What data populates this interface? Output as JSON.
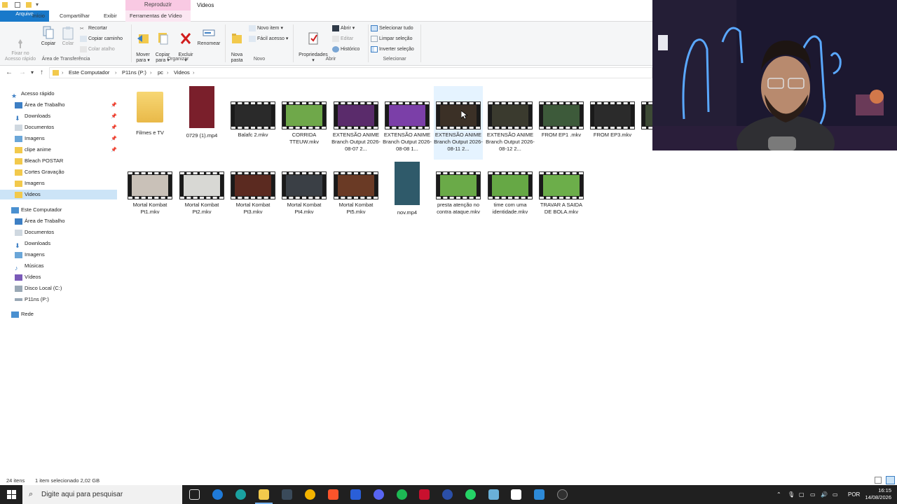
{
  "window": {
    "title": "Videos",
    "context_header": "Reproduzir"
  },
  "tabs": [
    {
      "label": "Arquivo"
    },
    {
      "label": "Início"
    },
    {
      "label": "Compartilhar"
    },
    {
      "label": "Exibir"
    },
    {
      "label": "Ferramentas de Vídeo"
    }
  ],
  "ribbon": {
    "clipboard": {
      "pin": "Fixar no\nAcesso rápido",
      "copy": "Copiar",
      "paste": "Colar",
      "cut": "Recortar",
      "copy_path": "Copiar caminho",
      "paste_shortcut": "Colar atalho",
      "group": "Área de Transferência"
    },
    "organize": {
      "move": "Mover\npara ▾",
      "copyto": "Copiar\npara ▾",
      "delete": "Excluir\n▾",
      "rename": "Renomear",
      "group": "Organizar"
    },
    "new": {
      "new_folder": "Nova\npasta",
      "new_item": "Novo item ▾",
      "easy_access": "Fácil acesso ▾",
      "group": "Novo"
    },
    "open": {
      "properties": "Propriedades\n▾",
      "open": "Abrir ▾",
      "edit": "Editar",
      "history": "Histórico",
      "group": "Abrir"
    },
    "select": {
      "select_all": "Selecionar tudo",
      "select_none": "Limpar seleção",
      "invert": "Inverter seleção",
      "group": "Selecionar"
    }
  },
  "address": {
    "crumbs": [
      "Este Computador",
      "P11ns (P:)",
      "pc",
      "Videos"
    ]
  },
  "nav": {
    "quick_access": "Acesso rápido",
    "quick_items": [
      "Área de Trabalho",
      "Downloads",
      "Documentos",
      "Imagens",
      "clipe anime",
      "Bleach POSTAR",
      "Cortes Gravação",
      "Imagens",
      "Videos"
    ],
    "this_pc": "Este Computador",
    "pc_items": [
      "Área de Trabalho",
      "Documentos",
      "Downloads",
      "Imagens",
      "Músicas",
      "Vídeos",
      "Disco Local (C:)",
      "P11ns (P:)"
    ],
    "network": "Rede"
  },
  "files": [
    {
      "name": "Filmes e TV",
      "kind": "folder"
    },
    {
      "name": "0729 (1).mp4",
      "kind": "portrait",
      "color": "#7a1f2b"
    },
    {
      "name": "Balafc 2.mkv",
      "kind": "video",
      "color": "#2a2a2a"
    },
    {
      "name": "CORRIDA TTEUW.mkv",
      "kind": "video",
      "color": "#6fa84a"
    },
    {
      "name": "EXTENSÃO ANIME Branch Output 2026-08-07 2...",
      "kind": "video",
      "color": "#5a2b6b"
    },
    {
      "name": "EXTENSÃO ANIME Branch Output 2026-08-08 1...",
      "kind": "video",
      "color": "#7b3fa8"
    },
    {
      "name": "EXTENSÃO ANIME Branch Output 2026-08-11 2...",
      "kind": "video",
      "color": "#3b3026",
      "selected": true
    },
    {
      "name": "EXTENSÃO ANIME Branch Output 2026-08-12 2...",
      "kind": "video",
      "color": "#3a3a2e"
    },
    {
      "name": "FROM EP1 .mkv",
      "kind": "video",
      "color": "#3d5a3a"
    },
    {
      "name": "FROM EP3.mkv",
      "kind": "video",
      "color": "#2b2b2b"
    },
    {
      "name": "FR",
      "kind": "video",
      "color": "#3d4a35"
    },
    {
      "name": "Mortal Kombat Pt1.mkv",
      "kind": "video",
      "color": "#c9c1b8"
    },
    {
      "name": "Mortal Kombat Pt2.mkv",
      "kind": "video",
      "color": "#d8d8d4"
    },
    {
      "name": "Mortal Kombat Pt3.mkv",
      "kind": "video",
      "color": "#5b2a20"
    },
    {
      "name": "Mortal Kombat Pt4.mkv",
      "kind": "video",
      "color": "#3a3f45"
    },
    {
      "name": "Mortal Kombat Pt5.mkv",
      "kind": "video",
      "color": "#6a3a25"
    },
    {
      "name": "nov.mp4",
      "kind": "portrait",
      "color": "#2f5a6a"
    },
    {
      "name": "presta atenção no contra ataque.mkv",
      "kind": "video",
      "color": "#6aaa48"
    },
    {
      "name": "time com uma identidade.mkv",
      "kind": "video",
      "color": "#66a845"
    },
    {
      "name": "TRAVAR A SAIDA DE BOLA.mkv",
      "kind": "video",
      "color": "#6cae4a"
    }
  ],
  "status": {
    "count": "24 itens",
    "selected": "1 item selecionado  2,02 GB"
  },
  "taskbar": {
    "search_placeholder": "Digite aqui para pesquisar",
    "lang": "POR",
    "time": "16:15",
    "date": "14/08/2026"
  }
}
